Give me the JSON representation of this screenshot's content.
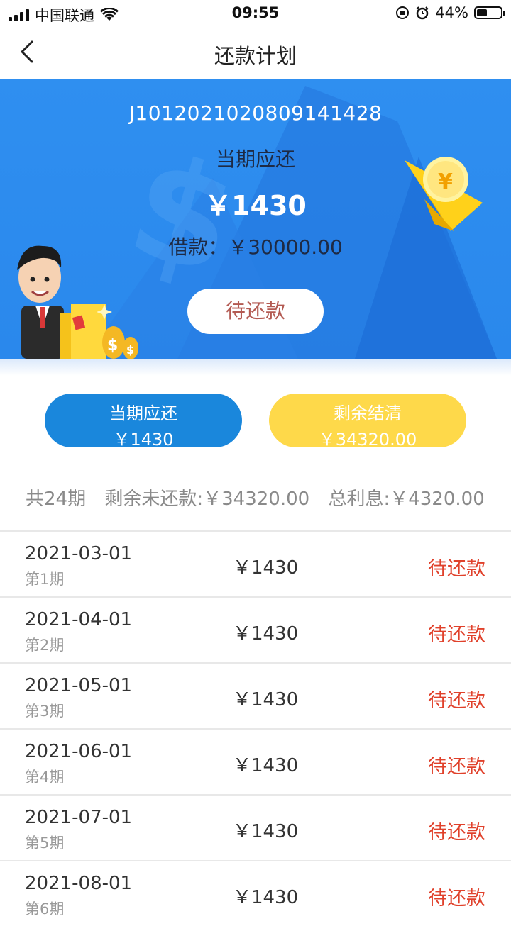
{
  "status_bar": {
    "carrier": "中国联通",
    "time": "09:55",
    "battery": "44%",
    "battery_level": 0.44,
    "icons": [
      "signal-icon",
      "wifi-icon",
      "orientation-lock-icon",
      "alarm-icon",
      "battery-icon"
    ]
  },
  "nav": {
    "title": "还款计划",
    "back_icon": "chevron-left-icon"
  },
  "hero": {
    "loan_no": "J1012021020809141428",
    "due_label": "当期应还",
    "due_amount": "￥1430",
    "loan_amount": "借款：￥30000.00",
    "status": "待还款",
    "colors": {
      "background": "#2f8ff0",
      "pill_text": "#b35a52"
    }
  },
  "actions": {
    "due": {
      "line1": "当期应还",
      "line2": "￥1430",
      "color": "#1a87dc"
    },
    "settle": {
      "line1": "剩余结清",
      "line2": "￥34320.00",
      "color": "#fed94a"
    }
  },
  "summary": {
    "periods": "共24期",
    "remaining": "剩余未还款:￥34320.00",
    "interest": "总利息:￥4320.00"
  },
  "installments": [
    {
      "date": "2021-03-01",
      "period": "第1期",
      "amount": "￥1430",
      "status": "待还款"
    },
    {
      "date": "2021-04-01",
      "period": "第2期",
      "amount": "￥1430",
      "status": "待还款"
    },
    {
      "date": "2021-05-01",
      "period": "第3期",
      "amount": "￥1430",
      "status": "待还款"
    },
    {
      "date": "2021-06-01",
      "period": "第4期",
      "amount": "￥1430",
      "status": "待还款"
    },
    {
      "date": "2021-07-01",
      "period": "第5期",
      "amount": "￥1430",
      "status": "待还款"
    },
    {
      "date": "2021-08-01",
      "period": "第6期",
      "amount": "￥1430",
      "status": "待还款"
    }
  ],
  "colors": {
    "status_pending": "#e0412b"
  }
}
